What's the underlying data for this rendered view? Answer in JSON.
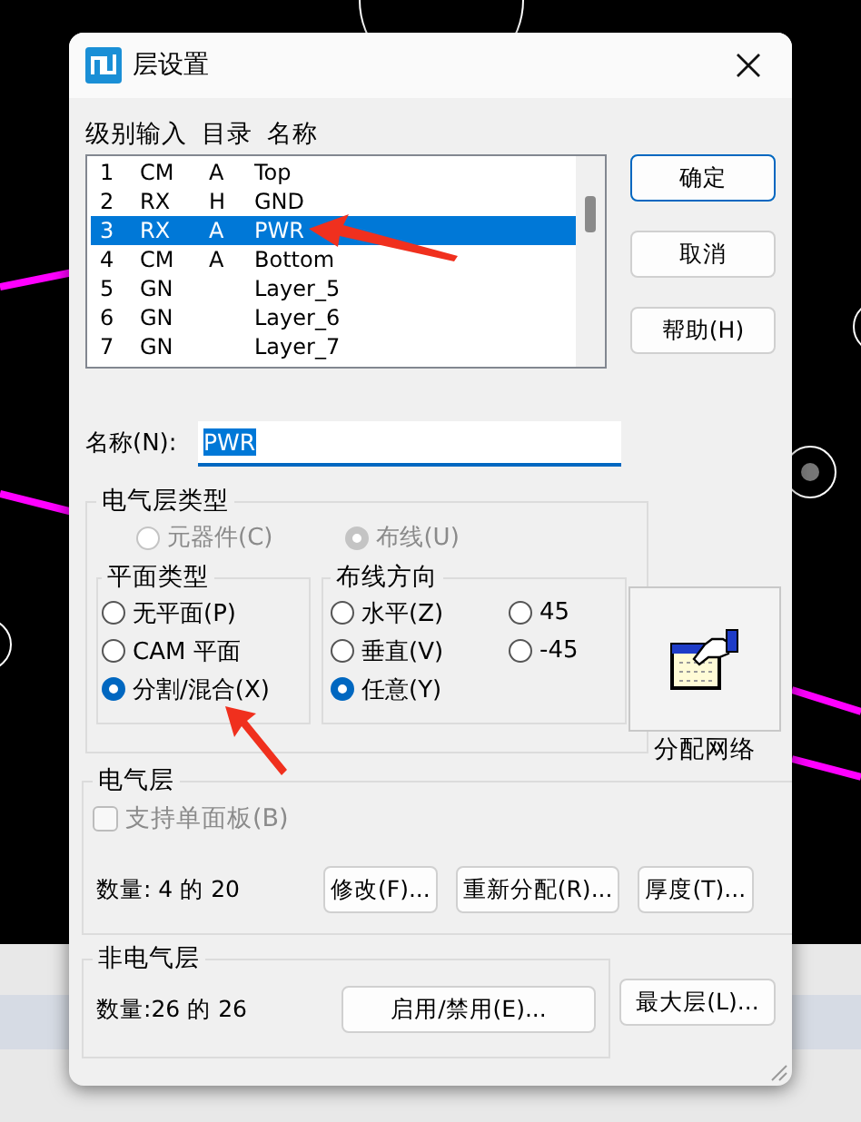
{
  "window": {
    "title": "层设置"
  },
  "list": {
    "columns": [
      "级别输入",
      "目录",
      "名称"
    ],
    "rows": [
      {
        "level": "1",
        "type": "CM",
        "dir": "A",
        "name": "Top",
        "selected": false
      },
      {
        "level": "2",
        "type": "RX",
        "dir": "H",
        "name": "GND",
        "selected": false
      },
      {
        "level": "3",
        "type": "RX",
        "dir": "A",
        "name": "PWR",
        "selected": true
      },
      {
        "level": "4",
        "type": "CM",
        "dir": "A",
        "name": "Bottom",
        "selected": false
      },
      {
        "level": "5",
        "type": "GN",
        "dir": "",
        "name": "Layer_5",
        "selected": false
      },
      {
        "level": "6",
        "type": "GN",
        "dir": "",
        "name": "Layer_6",
        "selected": false
      },
      {
        "level": "7",
        "type": "GN",
        "dir": "",
        "name": "Layer_7",
        "selected": false
      }
    ]
  },
  "buttons": [
    {
      "label": "确定",
      "default": true
    },
    {
      "label": "取消",
      "default": false
    },
    {
      "label": "帮助(H)",
      "default": false
    }
  ],
  "name_field": {
    "label": "名称(N):",
    "value": "PWR"
  },
  "electrical_layer_type": {
    "title": "电气层类型",
    "options": [
      {
        "label": "元器件(C)",
        "selected": false,
        "disabled": true
      },
      {
        "label": "布线(U)",
        "selected": true,
        "disabled": true
      }
    ],
    "plane_type": {
      "title": "平面类型",
      "options": [
        {
          "label": "无平面(P)",
          "selected": false
        },
        {
          "label": "CAM 平面",
          "selected": false
        },
        {
          "label": "分割/混合(X)",
          "selected": true
        }
      ]
    },
    "routing_direction": {
      "title": "布线方向",
      "options": [
        {
          "label": "水平(Z)",
          "selected": false
        },
        {
          "label": "45",
          "selected": false
        },
        {
          "label": "垂直(V)",
          "selected": false
        },
        {
          "label": "-45",
          "selected": false
        },
        {
          "label": "任意(Y)",
          "selected": true
        }
      ]
    }
  },
  "assign_nets": {
    "label": "分配网络"
  },
  "electrical_layers": {
    "title": "电气层",
    "checkbox": {
      "label": "支持单面板(B)",
      "checked": false,
      "disabled": true
    },
    "count": "数量: 4 的 20",
    "buttons": [
      "修改(F)...",
      "重新分配(R)...",
      "厚度(T)..."
    ]
  },
  "non_electrical_layers": {
    "title": "非电气层",
    "count": "数量:26 的 26",
    "button": "启用/禁用(E)...",
    "side_button": "最大层(L)..."
  }
}
